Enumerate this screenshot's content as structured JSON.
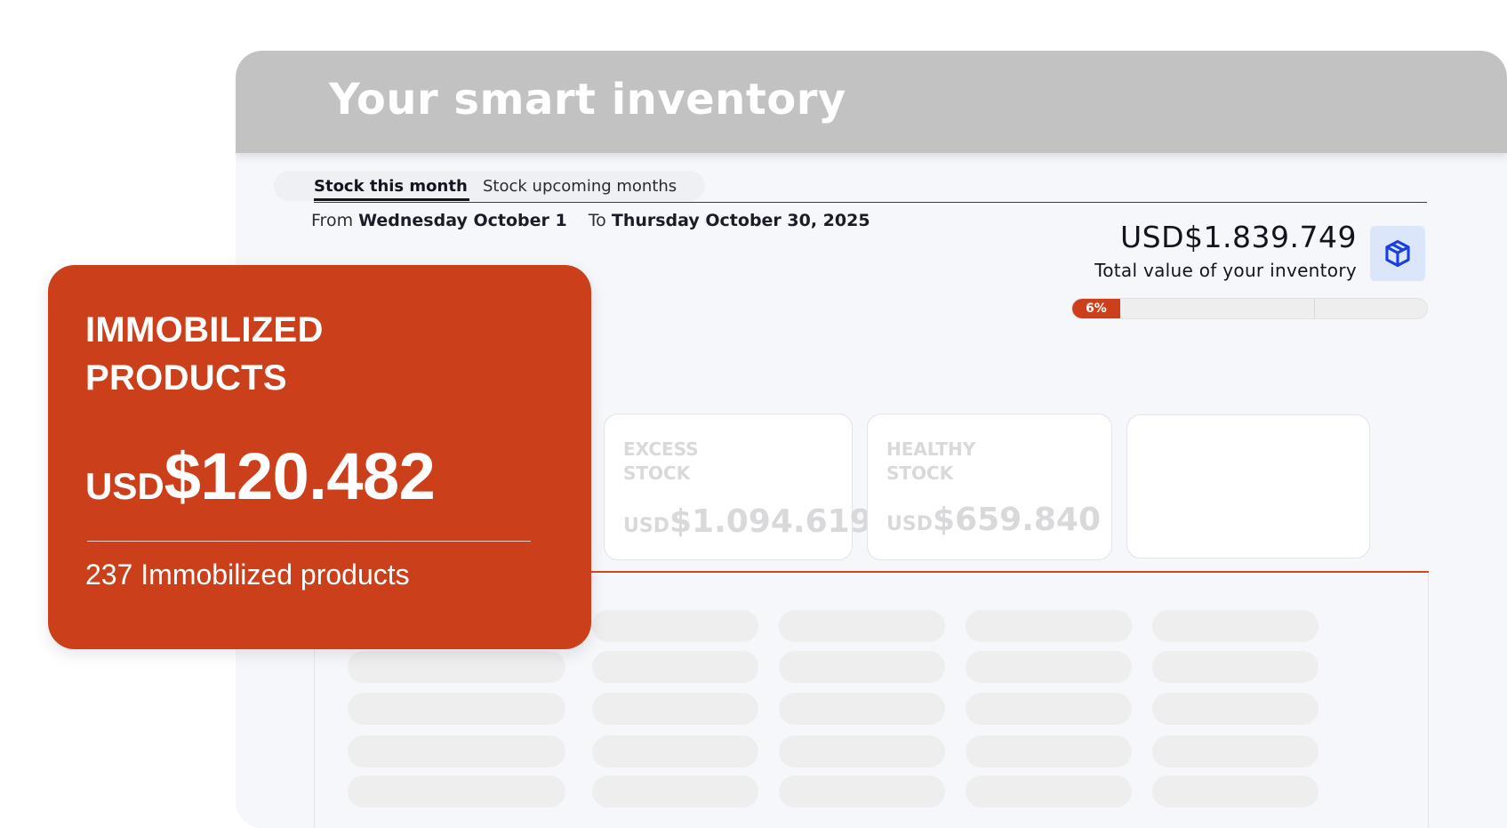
{
  "header": {
    "title": "Your smart inventory"
  },
  "tabs": [
    {
      "label": "Stock this month",
      "active": true
    },
    {
      "label": "Stock upcoming months",
      "active": false
    }
  ],
  "date_range": {
    "from_label": "From",
    "from_date": "Wednesday October 1",
    "to_label": "To",
    "to_date": "Thursday October 30, 2025"
  },
  "inventory": {
    "total_value": "USD$1.839.749",
    "total_label": "Total value of your inventory",
    "icon": "box-icon",
    "progress_label": "6%",
    "progress_fraction": 0.135
  },
  "cards": [
    {
      "title": "EXCESS STOCK",
      "currency": "USD",
      "value": "$1.094.619"
    },
    {
      "title": "HEALTHY STOCK",
      "currency": "USD",
      "value": "$659.840"
    }
  ],
  "immobilized": {
    "title_line1": "IMMOBILIZED",
    "title_line2": "PRODUCTS",
    "currency": "USD",
    "value": "$120.482",
    "count_text": "237 Immobilized products"
  },
  "colors": {
    "accent": "#cb3f1b",
    "header_bg": "#c2c2c2",
    "icon_bg": "#dbe6fb",
    "icon_color": "#1a3fe0"
  }
}
